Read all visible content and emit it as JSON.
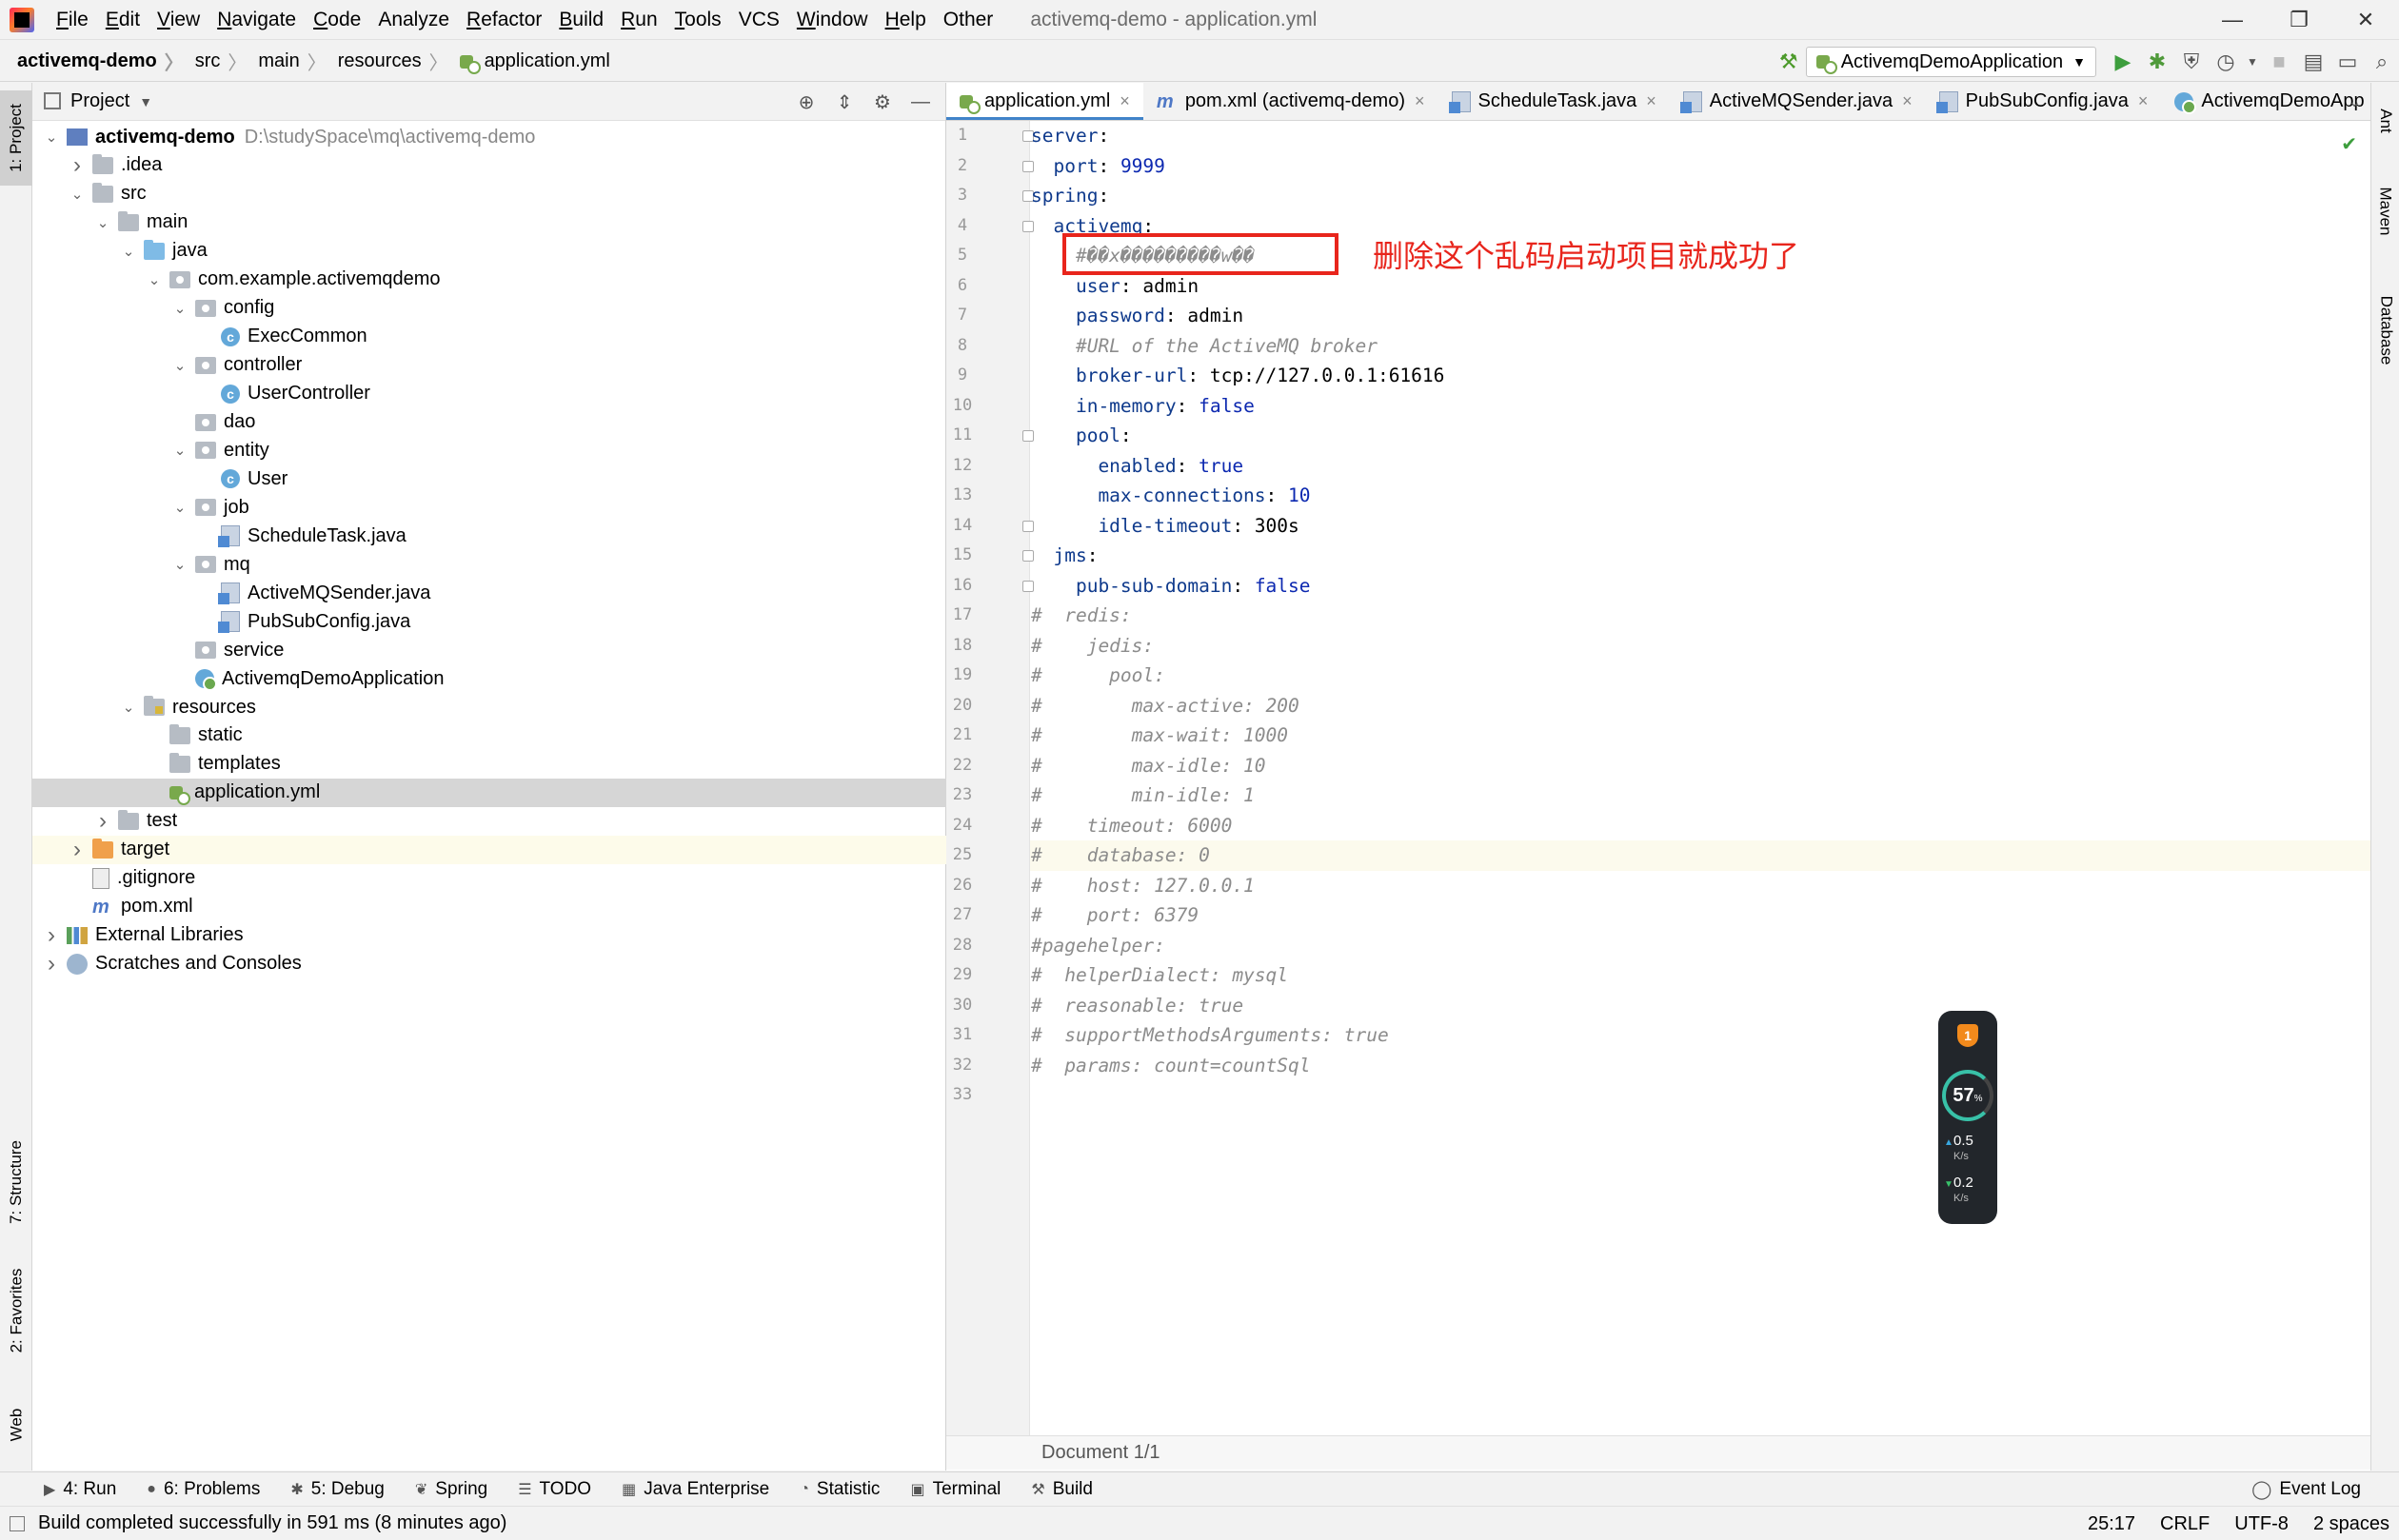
{
  "menubar": {
    "items": [
      {
        "mn": "F",
        "rest": "ile"
      },
      {
        "mn": "E",
        "rest": "dit"
      },
      {
        "mn": "V",
        "rest": "iew"
      },
      {
        "mn": "N",
        "rest": "avigate"
      },
      {
        "mn": "C",
        "rest": "ode"
      },
      {
        "mn": "",
        "rest": "Analyze"
      },
      {
        "mn": "R",
        "rest": "efactor"
      },
      {
        "mn": "B",
        "rest": "uild"
      },
      {
        "mn": "R",
        "rest": "un"
      },
      {
        "mn": "T",
        "rest": "ools"
      },
      {
        "mn": "",
        "rest": "VCS"
      },
      {
        "mn": "W",
        "rest": "indow"
      },
      {
        "mn": "H",
        "rest": "elp"
      },
      {
        "mn": "",
        "rest": "Other"
      }
    ],
    "window_title": "activemq-demo - application.yml"
  },
  "navbar": {
    "crumbs": [
      "activemq-demo",
      "src",
      "main",
      "resources",
      "application.yml"
    ],
    "run_config": "ActivemqDemoApplication"
  },
  "left_strip": {
    "project": "1: Project",
    "structure": "7: Structure",
    "favorites": "2: Favorites",
    "web": "Web"
  },
  "right_strip": {
    "ant": "Ant",
    "maven": "Maven",
    "database": "Database"
  },
  "project_panel": {
    "title": "Project",
    "tree": [
      {
        "label": "activemq-demo",
        "path": "D:\\studySpace\\mq\\activemq-demo"
      },
      {
        "label": ".idea"
      },
      {
        "label": "src"
      },
      {
        "label": "main"
      },
      {
        "label": "java"
      },
      {
        "label": "com.example.activemqdemo"
      },
      {
        "label": "config"
      },
      {
        "label": "ExecCommon"
      },
      {
        "label": "controller"
      },
      {
        "label": "UserController"
      },
      {
        "label": "dao"
      },
      {
        "label": "entity"
      },
      {
        "label": "User"
      },
      {
        "label": "job"
      },
      {
        "label": "ScheduleTask.java"
      },
      {
        "label": "mq"
      },
      {
        "label": "ActiveMQSender.java"
      },
      {
        "label": "PubSubConfig.java"
      },
      {
        "label": "service"
      },
      {
        "label": "ActivemqDemoApplication"
      },
      {
        "label": "resources"
      },
      {
        "label": "static"
      },
      {
        "label": "templates"
      },
      {
        "label": "application.yml"
      },
      {
        "label": "test"
      },
      {
        "label": "target"
      },
      {
        "label": ".gitignore"
      },
      {
        "label": "pom.xml"
      },
      {
        "label": "External Libraries"
      },
      {
        "label": "Scratches and Consoles"
      }
    ]
  },
  "editor": {
    "tabs": [
      {
        "label": "application.yml"
      },
      {
        "label": "pom.xml (activemq-demo)"
      },
      {
        "label": "ScheduleTask.java"
      },
      {
        "label": "ActiveMQSender.java"
      },
      {
        "label": "PubSubConfig.java"
      },
      {
        "label": "ActivemqDemoApp"
      }
    ],
    "lines": [
      [
        {
          "t": "server",
          "c": "k"
        },
        {
          "t": ":",
          "c": "p"
        }
      ],
      [
        {
          "t": "  port",
          "c": "k"
        },
        {
          "t": ": ",
          "c": "p"
        },
        {
          "t": "9999",
          "c": "v"
        }
      ],
      [
        {
          "t": "spring",
          "c": "k"
        },
        {
          "t": ":",
          "c": "p"
        }
      ],
      [
        {
          "t": "  activemq",
          "c": "k"
        },
        {
          "t": ":",
          "c": "p"
        }
      ],
      [
        {
          "t": "    #��x���������w��",
          "c": "c"
        }
      ],
      [
        {
          "t": "    user",
          "c": "k"
        },
        {
          "t": ": admin",
          "c": "p"
        }
      ],
      [
        {
          "t": "    password",
          "c": "k"
        },
        {
          "t": ": admin",
          "c": "p"
        }
      ],
      [
        {
          "t": "    #URL of the ActiveMQ broker",
          "c": "c"
        }
      ],
      [
        {
          "t": "    broker-url",
          "c": "k"
        },
        {
          "t": ": tcp://127.0.0.1:61616",
          "c": "p"
        }
      ],
      [
        {
          "t": "    in-memory",
          "c": "k"
        },
        {
          "t": ": ",
          "c": "p"
        },
        {
          "t": "false",
          "c": "v"
        }
      ],
      [
        {
          "t": "    pool",
          "c": "k"
        },
        {
          "t": ":",
          "c": "p"
        }
      ],
      [
        {
          "t": "      enabled",
          "c": "k"
        },
        {
          "t": ": ",
          "c": "p"
        },
        {
          "t": "true",
          "c": "v"
        }
      ],
      [
        {
          "t": "      max-connections",
          "c": "k"
        },
        {
          "t": ": ",
          "c": "p"
        },
        {
          "t": "10",
          "c": "v"
        }
      ],
      [
        {
          "t": "      idle-timeout",
          "c": "k"
        },
        {
          "t": ": 300s",
          "c": "p"
        }
      ],
      [
        {
          "t": "  jms",
          "c": "k"
        },
        {
          "t": ":",
          "c": "p"
        }
      ],
      [
        {
          "t": "    pub-sub-domain",
          "c": "k"
        },
        {
          "t": ": ",
          "c": "p"
        },
        {
          "t": "false",
          "c": "v"
        }
      ],
      [
        {
          "t": "#  redis:",
          "c": "c"
        }
      ],
      [
        {
          "t": "#    jedis:",
          "c": "c"
        }
      ],
      [
        {
          "t": "#      pool:",
          "c": "c"
        }
      ],
      [
        {
          "t": "#        max-active: 200",
          "c": "c"
        }
      ],
      [
        {
          "t": "#        max-wait: 1000",
          "c": "c"
        }
      ],
      [
        {
          "t": "#        max-idle: 10",
          "c": "c"
        }
      ],
      [
        {
          "t": "#        min-idle: 1",
          "c": "c"
        }
      ],
      [
        {
          "t": "#    timeout: 6000",
          "c": "c"
        }
      ],
      [
        {
          "t": "#    database: 0",
          "c": "c"
        }
      ],
      [
        {
          "t": "#    host: 127.0.0.1",
          "c": "c"
        }
      ],
      [
        {
          "t": "#    port: 6379",
          "c": "c"
        }
      ],
      [
        {
          "t": "#pagehelper:",
          "c": "c"
        }
      ],
      [
        {
          "t": "#  helperDialect: mysql",
          "c": "c"
        }
      ],
      [
        {
          "t": "#  reasonable: true",
          "c": "c"
        }
      ],
      [
        {
          "t": "#  supportMethodsArguments: true",
          "c": "c"
        }
      ],
      [
        {
          "t": "#  params: count=countSql",
          "c": "c"
        }
      ],
      []
    ],
    "annotation": "删除这个乱码启动项目就成功了",
    "document_status": "Document 1/1"
  },
  "net_widget": {
    "badge": "1",
    "percent": "57",
    "percent_unit": "%",
    "upload": "0.5",
    "download": "0.2",
    "unit": "K/s"
  },
  "bottom_tabs": [
    {
      "icon": "▶",
      "label": "4: Run"
    },
    {
      "icon": "●",
      "label": "6: Problems"
    },
    {
      "icon": "✱",
      "label": "5: Debug"
    },
    {
      "icon": "❦",
      "label": "Spring"
    },
    {
      "icon": "☰",
      "label": "TODO"
    },
    {
      "icon": "▦",
      "label": "Java Enterprise"
    },
    {
      "icon": "◔",
      "label": "Statistic"
    },
    {
      "icon": "▣",
      "label": "Terminal"
    },
    {
      "icon": "⚒",
      "label": "Build"
    }
  ],
  "event_log": "Event Log",
  "statusbar": {
    "message": "Build completed successfully in 591 ms (8 minutes ago)",
    "position": "25:17",
    "line_sep": "CRLF",
    "encoding": "UTF-8",
    "indent": "2 spaces"
  },
  "colors": {
    "accent": "#4083c9",
    "annotation": "#e8251c",
    "yaml_key": "#0f3a8c",
    "yaml_value": "#0c28b0",
    "comment": "#8c8c8c"
  }
}
